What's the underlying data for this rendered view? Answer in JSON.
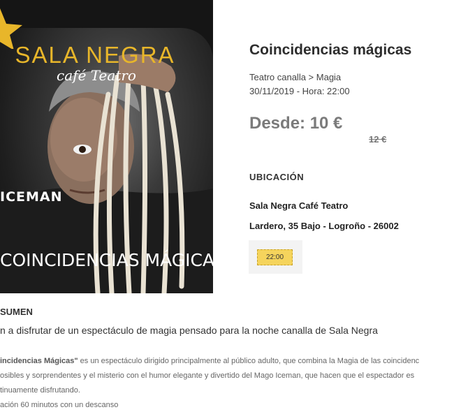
{
  "poster": {
    "venue_logo": "SALA NEGRA",
    "venue_logo_sub": "café Teatro",
    "artist": "ICEMAN",
    "show_title": "COINCIDENCIAS MÁGICAS",
    "accent_color": "#e8b62a"
  },
  "event": {
    "title": "Coincidencias mágicas",
    "category": "Teatro canalla > Magia",
    "date": "30/11/2019 - Hora: 22:00",
    "price_from": "Desde: 10 €",
    "price_old": "12 €"
  },
  "location": {
    "heading": "UBICACIÓN",
    "venue": "Sala Negra Café Teatro",
    "address": "Lardero, 35 Bajo - Logroño - 26002"
  },
  "session": {
    "time": "22:00",
    "color": "#f5d45c"
  },
  "summary": {
    "heading": "SUMEN",
    "lead": "n a disfrutar de un espectáculo de magia pensado para la noche  canalla de Sala Negra",
    "body_title": "incidencias Mágicas\"",
    "body_line1_rest": " es un espectáculo dirigido principalmente al público adulto, que combina la Magia de las coincidenc",
    "body_line2": "osibles y sorprendentes y el misterio con el humor elegante y divertido del Mago Iceman, que hacen que el espectador es",
    "body_line3": "tinuamente disfrutando.",
    "duration": "ación 60 minutos con un descanso"
  }
}
